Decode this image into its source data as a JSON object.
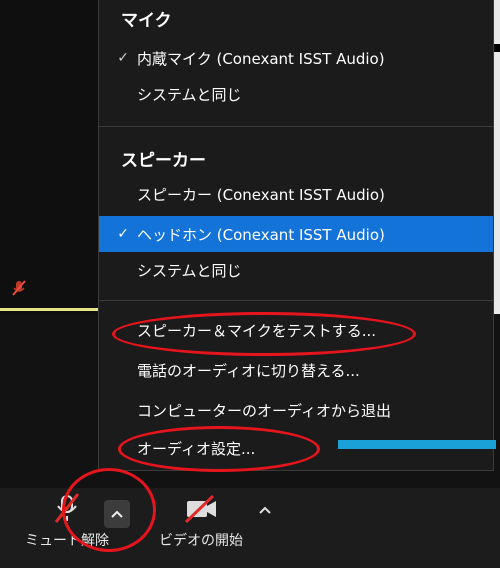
{
  "menu": {
    "mic_section": {
      "title": "マイク",
      "items": [
        {
          "check": "✓",
          "label": "内蔵マイク (Conexant ISST Audio)"
        },
        {
          "check": "",
          "label": "システムと同じ"
        }
      ]
    },
    "speaker_section": {
      "title": "スピーカー",
      "items": [
        {
          "check": "",
          "label": "スピーカー (Conexant ISST Audio)"
        },
        {
          "check": "✓",
          "label": "ヘッドホン (Conexant ISST Audio)"
        },
        {
          "check": "",
          "label": "システムと同じ"
        }
      ]
    },
    "actions": [
      {
        "label": "スピーカー＆マイクをテストする..."
      },
      {
        "label": "電話のオーディオに切り替える..."
      },
      {
        "label": "コンピューターのオーディオから退出"
      },
      {
        "label": "オーディオ設定..."
      }
    ]
  },
  "toolbar": {
    "unmute_label": "ミュート解除",
    "video_label": "ビデオの開始"
  },
  "colors": {
    "selected": "#1373d9",
    "annotation": "#e6141c",
    "highlight_bar": "#1aa1d8"
  }
}
